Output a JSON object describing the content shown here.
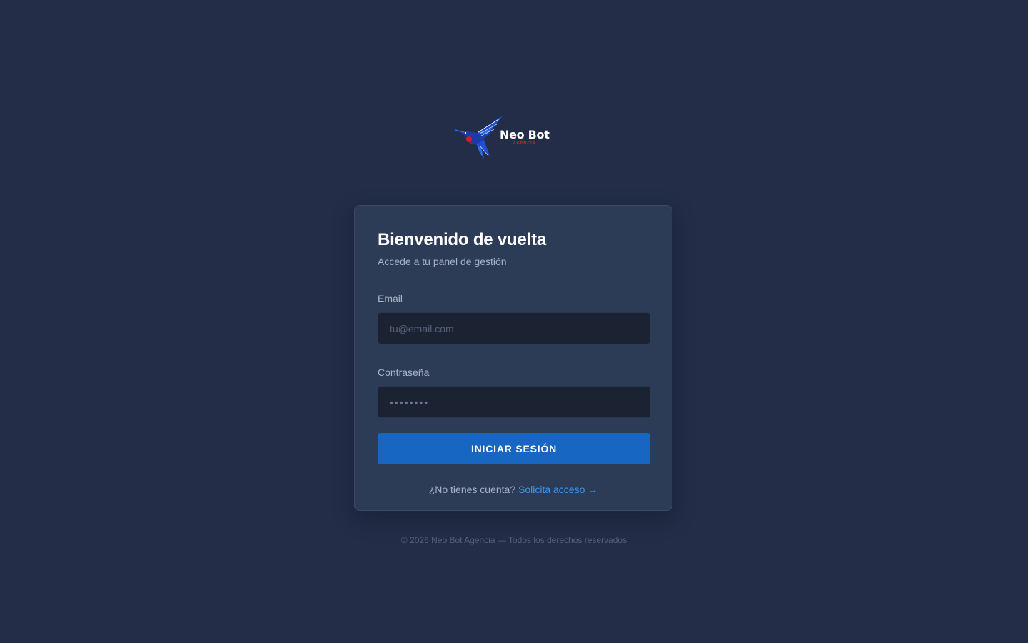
{
  "brand": {
    "name": "Neo Bot",
    "tagline": "AGENCIA",
    "colors": {
      "accent": "#1766c2",
      "link": "#3e95ec",
      "brand_red": "#d11a2a",
      "background": "#232d47",
      "card": "#2d3c56"
    }
  },
  "login": {
    "title": "Bienvenido de vuelta",
    "subtitle": "Accede a tu panel de gestión",
    "email": {
      "label": "Email",
      "placeholder": "tu@email.com",
      "value": ""
    },
    "password": {
      "label": "Contraseña",
      "placeholder": "••••••••",
      "value": ""
    },
    "submit_label": "INICIAR SESIÓN",
    "signup_prompt": "¿No tienes cuenta?",
    "signup_link": "Solicita acceso →"
  },
  "footer": {
    "text": "© 2026 Neo Bot Agencia — Todos los derechos reservados"
  }
}
